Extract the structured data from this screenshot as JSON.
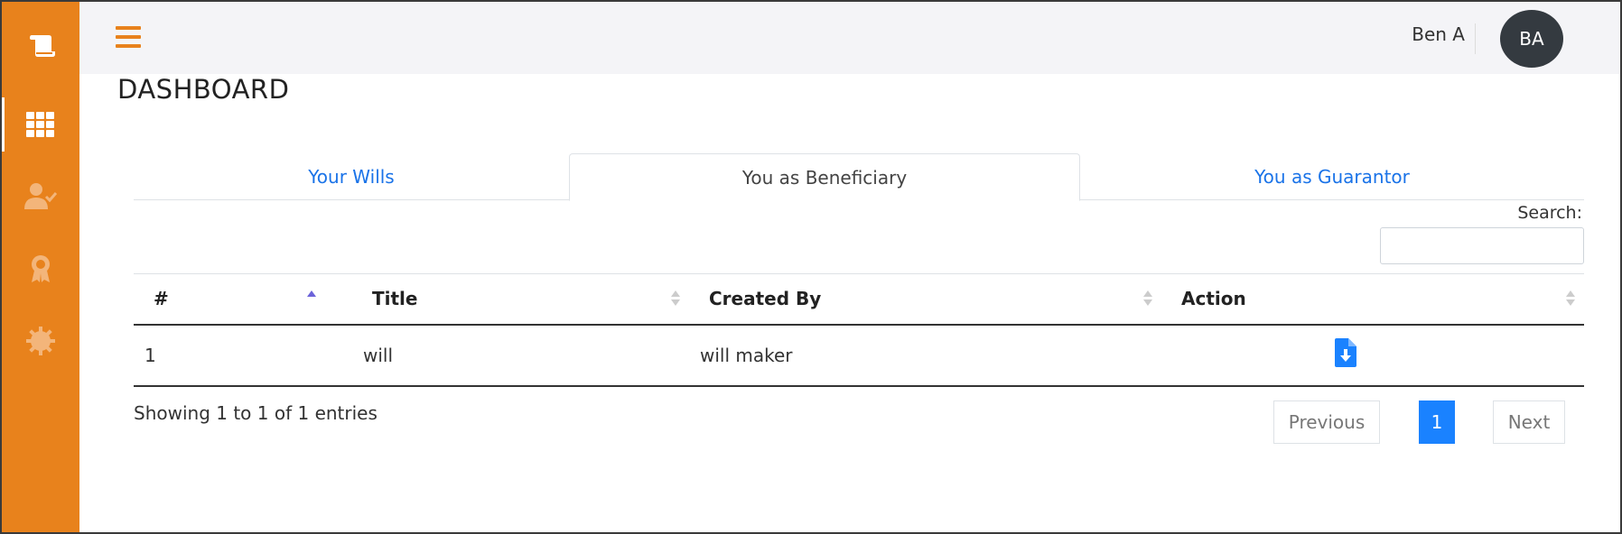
{
  "header": {
    "user_name": "Ben A",
    "avatar_initials": "BA"
  },
  "sidebar": {
    "items": [
      {
        "icon": "scroll-icon"
      },
      {
        "icon": "grid-icon",
        "active": true
      },
      {
        "icon": "user-check-icon"
      },
      {
        "icon": "award-icon"
      },
      {
        "icon": "gear-icon"
      }
    ]
  },
  "page": {
    "title": "DASHBOARD"
  },
  "tabs": [
    {
      "label": "Your Wills"
    },
    {
      "label": "You as Beneficiary",
      "active": true
    },
    {
      "label": "You as Guarantor"
    }
  ],
  "search": {
    "label": "Search:",
    "value": ""
  },
  "table": {
    "columns": [
      "#",
      "Title",
      "Created By",
      "Action"
    ],
    "rows": [
      {
        "num": "1",
        "title": "will",
        "created_by": "will maker",
        "action_icon": "file-download-icon"
      }
    ]
  },
  "footer": {
    "showing": "Showing 1 to 1 of 1 entries"
  },
  "pagination": {
    "previous": "Previous",
    "current_page": "1",
    "next": "Next"
  },
  "colors": {
    "brand_orange": "#e8821c",
    "link_blue": "#1a73e8",
    "pager_active": "#1a82ff",
    "avatar_bg": "#343a40"
  }
}
